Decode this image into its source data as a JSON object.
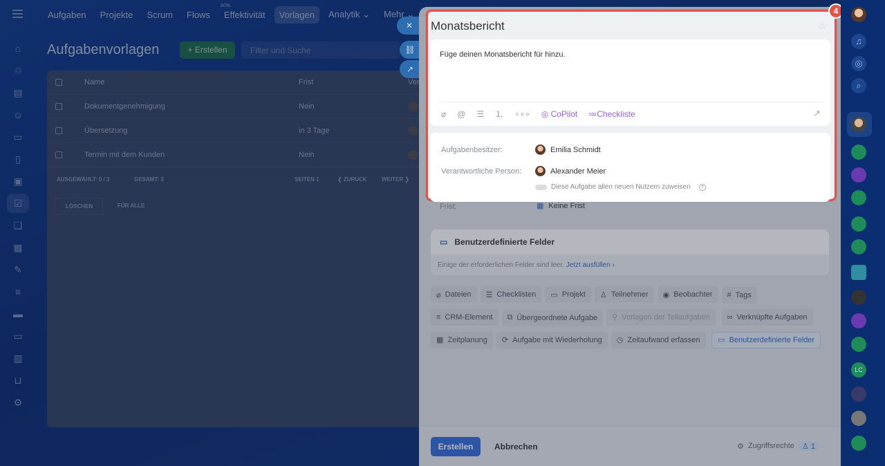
{
  "topnav": {
    "items": [
      "Aufgaben",
      "Projekte",
      "Scrum",
      "Flows",
      "Effektivität",
      "Vorlagen",
      "Analytik ⌄",
      "Mehr ⌄"
    ],
    "effectivity_pct": "60%",
    "active": "Vorlagen"
  },
  "page": {
    "title": "Aufgabenvorlagen",
    "create": "+ Erstellen",
    "search_placeholder": "Filter und Suche"
  },
  "grid": {
    "headers": {
      "name": "Name",
      "frist": "Frist",
      "ver": "Ver"
    },
    "rows": [
      {
        "name": "Dokumentgenehmigung",
        "frist": "Nein"
      },
      {
        "name": "Übersetzung",
        "frist": "in 3 Tage"
      },
      {
        "name": "Termin mit dem Kunden",
        "frist": "Nein"
      }
    ],
    "footer": {
      "selected": "AUSGEWÄHLT: 0 / 3",
      "total": "GESAMT: 3",
      "pages": "SEITEN  1",
      "back": "❮ ZURÜCK",
      "next": "WEITER ❯"
    },
    "delete": "LÖSCHEN",
    "for_all": "FÜR ALLE"
  },
  "panel": {
    "title": "Monatsbericht",
    "description": "Füge deinen Monatsbericht für hinzu.",
    "toolbar": {
      "copilot": "CoPilot",
      "checklist": "Checkliste"
    },
    "owner_label": "Aufgabenbesitzer:",
    "owner": "Emilia Schmidt",
    "responsible_label": "Verantwortliche Person:",
    "responsible": "Alexander Meier",
    "assign_all": "Diese Aufgabe allen neuen Nutzern zuweisen",
    "deadline_label": "Frist:",
    "deadline": "Keine Frist",
    "custom_fields_title": "Benutzerdefinierte Felder",
    "custom_fields_hint": "Einige der erforderlichen Felder sind leer.",
    "fill_now": "Jetzt ausfüllen ›",
    "chips": [
      "Dateien",
      "Checklisten",
      "Projekt",
      "Teilnehmer",
      "Beobachter",
      "Tags",
      "CRM-Element",
      "Übergeordnete Aufgabe",
      "Vorlagen der Teilaufgaben",
      "Verknüpfte Aufgaben",
      "Zeitplanung",
      "Aufgabe mit Wiederholung",
      "Zeitaufwand erfassen",
      "Benutzerdefinierte Felder"
    ],
    "create": "Erstellen",
    "cancel": "Abbrechen",
    "access": "Zugriffsrechte",
    "access_count": "1"
  },
  "badge": "4",
  "right_sidebar": {
    "lc": "LC"
  }
}
